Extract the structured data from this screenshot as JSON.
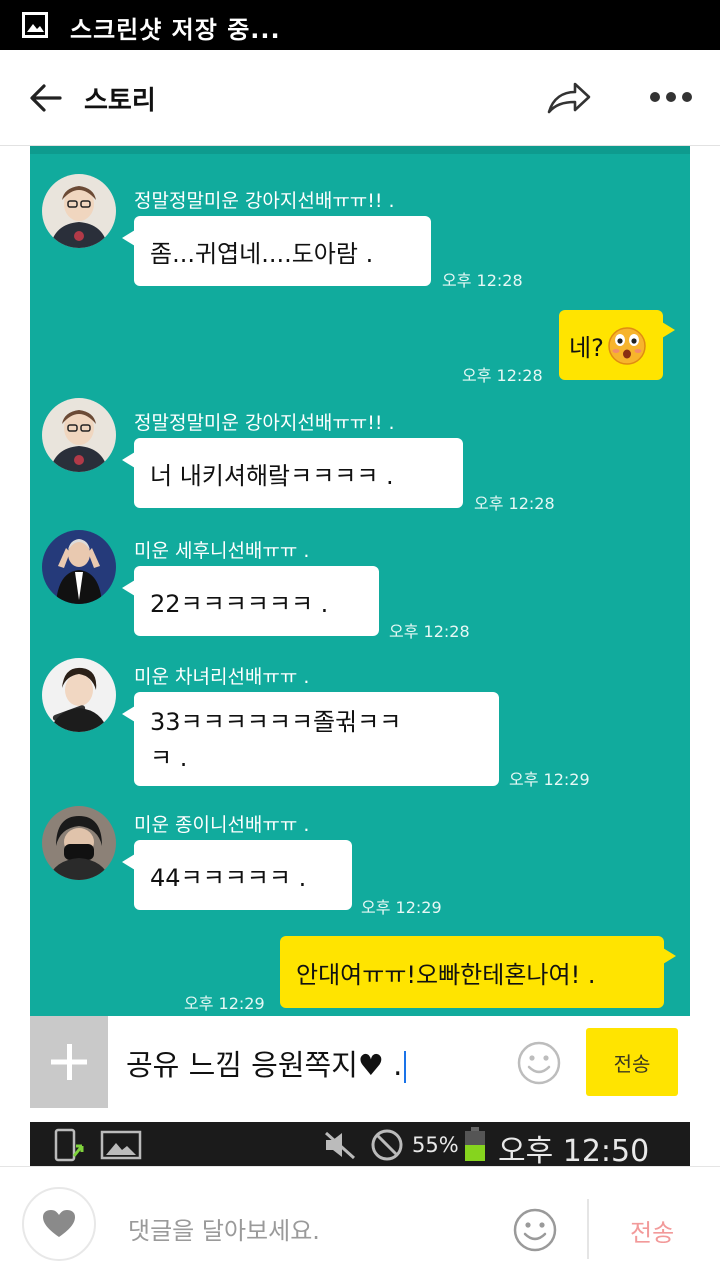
{
  "status_bar": {
    "icon": "gallery-icon",
    "text": "스크린샷 저장 중..."
  },
  "app_bar": {
    "title": "스토리",
    "back_icon": "back-arrow-icon",
    "share_icon": "share-icon",
    "more_icon": "more-icon"
  },
  "chat": {
    "background": "#11ab9d",
    "messages": [
      {
        "sender": "정말정말미운 강아지선배ㅠㅠ!! .",
        "text": "좀...귀엽네....도아람 .",
        "time": "오후 12:28"
      },
      {
        "text": "네?",
        "time": "오후 12:28",
        "emoji": "surprised-face-emoji"
      },
      {
        "sender": "정말정말미운 강아지선배ㅠㅠ!! .",
        "text": "너 내키셔해랔ㅋㅋㅋㅋ .",
        "time": "오후 12:28"
      },
      {
        "sender": "미운 세후니선배ㅠㅠ .",
        "text": "22ㅋㅋㅋㅋㅋㅋ .",
        "time": "오후 12:28"
      },
      {
        "sender": "미운 차녀리선배ㅠㅠ .",
        "text_line1": "33ㅋㅋㅋㅋㅋㅋ졸귂ㅋㅋ",
        "text_line2": "ㅋ .",
        "time": "오후 12:29"
      },
      {
        "sender": "미운 종이니선배ㅠㅠ .",
        "text": "44ㅋㅋㅋㅋㅋ .",
        "time": "오후 12:29"
      },
      {
        "text": "안대여ㅠㅠ!오빠한테혼나여! .",
        "time": "오후 12:29"
      }
    ]
  },
  "input": {
    "text": "공유 느낌 응원쪽지♥ .",
    "send_label": "전송"
  },
  "phone_status": {
    "battery": "55%",
    "time": "오후 12:50"
  },
  "bottom_bar": {
    "placeholder": "댓글을 달아보세요.",
    "send_label": "전송"
  }
}
